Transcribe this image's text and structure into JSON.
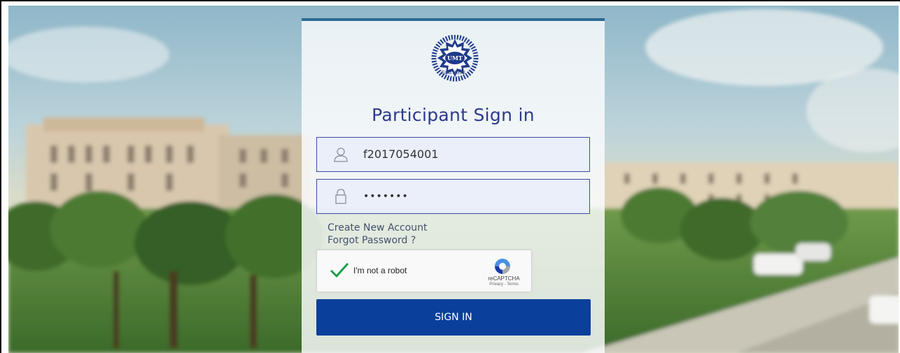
{
  "page": {
    "title": "Participant Sign in",
    "logo": {
      "abbr": "UMT",
      "arc_text": "UNIVERSITY OF MANAGEMENT AND TECHNOLOGY",
      "estd": "Estd. 1990",
      "icon": "umt-logo"
    }
  },
  "form": {
    "username": {
      "value": "f2017054001",
      "icon": "user-icon"
    },
    "password": {
      "value": "•••••••",
      "icon": "lock-icon"
    },
    "links": {
      "create_account": "Create New Account",
      "forgot_password": "Forgot Password ?"
    },
    "captcha": {
      "label": "I'm not a robot",
      "checked": true,
      "brand": "reCAPTCHA",
      "links": "Privacy - Terms"
    },
    "submit_label": "SIGN IN"
  },
  "colors": {
    "accent": "#0a3f9c",
    "title": "#2b3a8c",
    "card_top_border": "#2d6a93",
    "check": "#1e9e4a"
  }
}
